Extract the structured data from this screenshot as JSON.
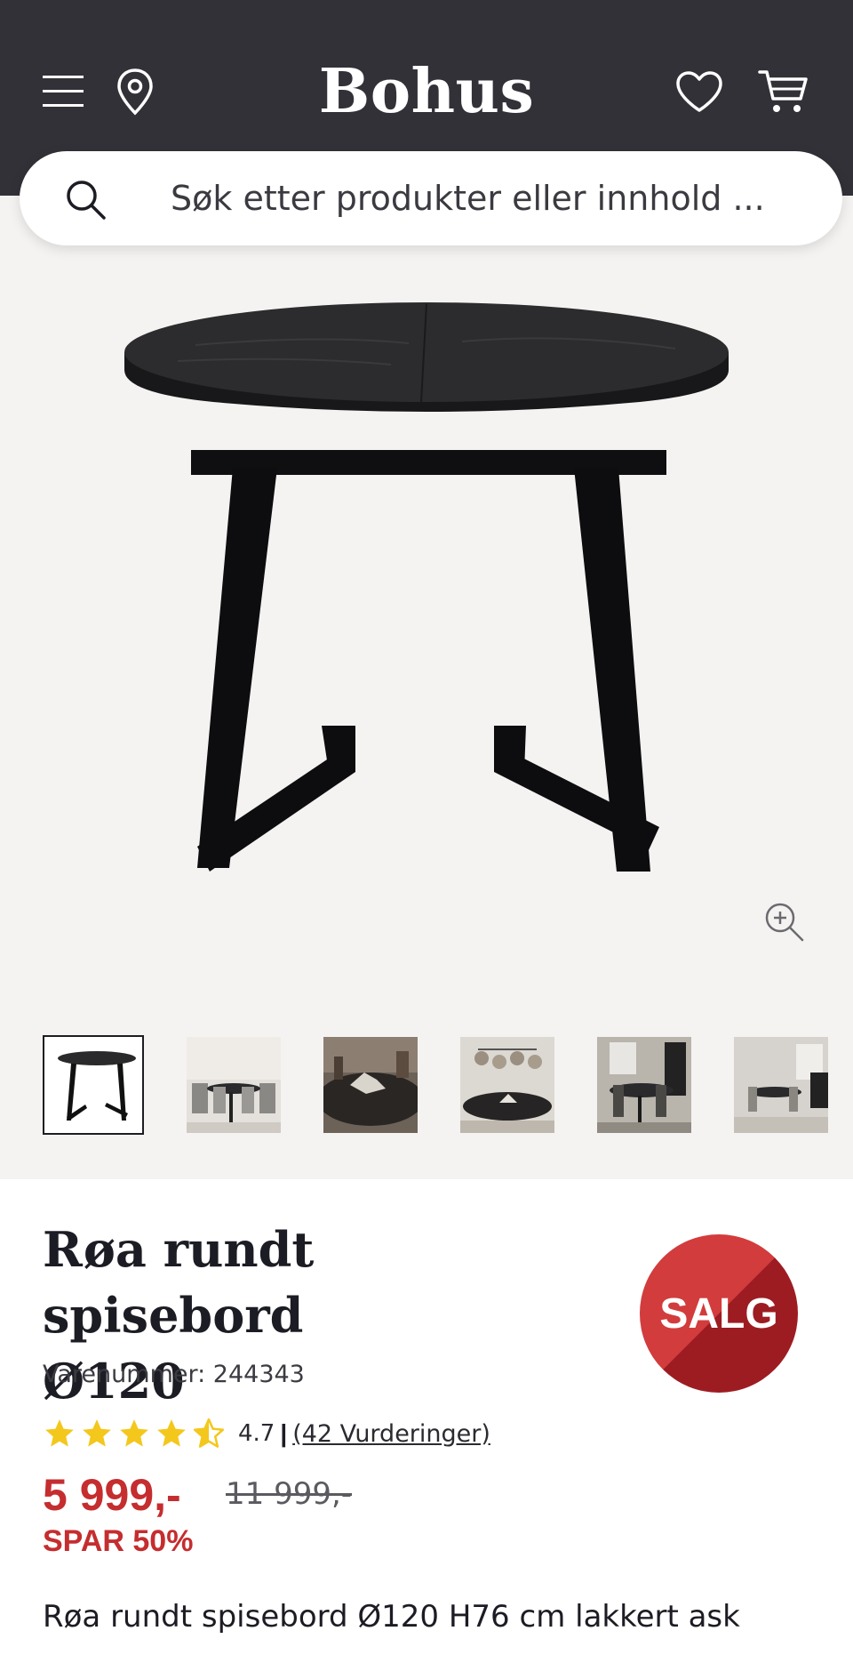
{
  "header": {
    "logo": "Bohus",
    "icons": [
      "menu-icon",
      "location-pin-icon",
      "heart-icon",
      "cart-icon"
    ]
  },
  "search": {
    "placeholder": "Søk etter produkter eller innhold ..."
  },
  "gallery": {
    "thumbnails": [
      "table-cutout",
      "dining-room-scene",
      "table-detail",
      "pendant-lamp-scene",
      "dining-set-scene",
      "dining-room-wide"
    ],
    "active_index": 0
  },
  "product": {
    "title_line1": "Røa rundt spisebord",
    "title_line2": "Ø120",
    "sku": "Varenummer: 244343",
    "badge": "SALG",
    "rating_value": "4.7",
    "rating_stars": 4.5,
    "rating_separator": "|",
    "rating_count_link": "(42 Vurderinger)",
    "price": "5 999,-",
    "old_price": "11 999,-",
    "saving": "SPAR 50%",
    "description": "Røa rundt spisebord Ø120 H76 cm lakkert ask"
  },
  "colors": {
    "header_bg": "#323138",
    "sale_red": "#c52d2f",
    "badge_dark": "#9d1c22",
    "star": "#f4c71c"
  }
}
